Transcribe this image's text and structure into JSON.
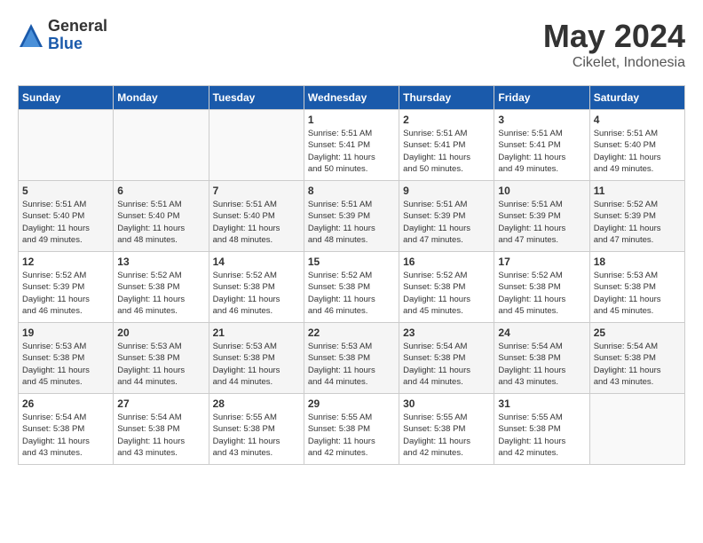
{
  "logo": {
    "general": "General",
    "blue": "Blue"
  },
  "title": {
    "month": "May 2024",
    "location": "Cikelet, Indonesia"
  },
  "headers": [
    "Sunday",
    "Monday",
    "Tuesday",
    "Wednesday",
    "Thursday",
    "Friday",
    "Saturday"
  ],
  "weeks": [
    [
      {
        "day": "",
        "info": ""
      },
      {
        "day": "",
        "info": ""
      },
      {
        "day": "",
        "info": ""
      },
      {
        "day": "1",
        "info": "Sunrise: 5:51 AM\nSunset: 5:41 PM\nDaylight: 11 hours\nand 50 minutes."
      },
      {
        "day": "2",
        "info": "Sunrise: 5:51 AM\nSunset: 5:41 PM\nDaylight: 11 hours\nand 50 minutes."
      },
      {
        "day": "3",
        "info": "Sunrise: 5:51 AM\nSunset: 5:41 PM\nDaylight: 11 hours\nand 49 minutes."
      },
      {
        "day": "4",
        "info": "Sunrise: 5:51 AM\nSunset: 5:40 PM\nDaylight: 11 hours\nand 49 minutes."
      }
    ],
    [
      {
        "day": "5",
        "info": "Sunrise: 5:51 AM\nSunset: 5:40 PM\nDaylight: 11 hours\nand 49 minutes."
      },
      {
        "day": "6",
        "info": "Sunrise: 5:51 AM\nSunset: 5:40 PM\nDaylight: 11 hours\nand 48 minutes."
      },
      {
        "day": "7",
        "info": "Sunrise: 5:51 AM\nSunset: 5:40 PM\nDaylight: 11 hours\nand 48 minutes."
      },
      {
        "day": "8",
        "info": "Sunrise: 5:51 AM\nSunset: 5:39 PM\nDaylight: 11 hours\nand 48 minutes."
      },
      {
        "day": "9",
        "info": "Sunrise: 5:51 AM\nSunset: 5:39 PM\nDaylight: 11 hours\nand 47 minutes."
      },
      {
        "day": "10",
        "info": "Sunrise: 5:51 AM\nSunset: 5:39 PM\nDaylight: 11 hours\nand 47 minutes."
      },
      {
        "day": "11",
        "info": "Sunrise: 5:52 AM\nSunset: 5:39 PM\nDaylight: 11 hours\nand 47 minutes."
      }
    ],
    [
      {
        "day": "12",
        "info": "Sunrise: 5:52 AM\nSunset: 5:39 PM\nDaylight: 11 hours\nand 46 minutes."
      },
      {
        "day": "13",
        "info": "Sunrise: 5:52 AM\nSunset: 5:38 PM\nDaylight: 11 hours\nand 46 minutes."
      },
      {
        "day": "14",
        "info": "Sunrise: 5:52 AM\nSunset: 5:38 PM\nDaylight: 11 hours\nand 46 minutes."
      },
      {
        "day": "15",
        "info": "Sunrise: 5:52 AM\nSunset: 5:38 PM\nDaylight: 11 hours\nand 46 minutes."
      },
      {
        "day": "16",
        "info": "Sunrise: 5:52 AM\nSunset: 5:38 PM\nDaylight: 11 hours\nand 45 minutes."
      },
      {
        "day": "17",
        "info": "Sunrise: 5:52 AM\nSunset: 5:38 PM\nDaylight: 11 hours\nand 45 minutes."
      },
      {
        "day": "18",
        "info": "Sunrise: 5:53 AM\nSunset: 5:38 PM\nDaylight: 11 hours\nand 45 minutes."
      }
    ],
    [
      {
        "day": "19",
        "info": "Sunrise: 5:53 AM\nSunset: 5:38 PM\nDaylight: 11 hours\nand 45 minutes."
      },
      {
        "day": "20",
        "info": "Sunrise: 5:53 AM\nSunset: 5:38 PM\nDaylight: 11 hours\nand 44 minutes."
      },
      {
        "day": "21",
        "info": "Sunrise: 5:53 AM\nSunset: 5:38 PM\nDaylight: 11 hours\nand 44 minutes."
      },
      {
        "day": "22",
        "info": "Sunrise: 5:53 AM\nSunset: 5:38 PM\nDaylight: 11 hours\nand 44 minutes."
      },
      {
        "day": "23",
        "info": "Sunrise: 5:54 AM\nSunset: 5:38 PM\nDaylight: 11 hours\nand 44 minutes."
      },
      {
        "day": "24",
        "info": "Sunrise: 5:54 AM\nSunset: 5:38 PM\nDaylight: 11 hours\nand 43 minutes."
      },
      {
        "day": "25",
        "info": "Sunrise: 5:54 AM\nSunset: 5:38 PM\nDaylight: 11 hours\nand 43 minutes."
      }
    ],
    [
      {
        "day": "26",
        "info": "Sunrise: 5:54 AM\nSunset: 5:38 PM\nDaylight: 11 hours\nand 43 minutes."
      },
      {
        "day": "27",
        "info": "Sunrise: 5:54 AM\nSunset: 5:38 PM\nDaylight: 11 hours\nand 43 minutes."
      },
      {
        "day": "28",
        "info": "Sunrise: 5:55 AM\nSunset: 5:38 PM\nDaylight: 11 hours\nand 43 minutes."
      },
      {
        "day": "29",
        "info": "Sunrise: 5:55 AM\nSunset: 5:38 PM\nDaylight: 11 hours\nand 42 minutes."
      },
      {
        "day": "30",
        "info": "Sunrise: 5:55 AM\nSunset: 5:38 PM\nDaylight: 11 hours\nand 42 minutes."
      },
      {
        "day": "31",
        "info": "Sunrise: 5:55 AM\nSunset: 5:38 PM\nDaylight: 11 hours\nand 42 minutes."
      },
      {
        "day": "",
        "info": ""
      }
    ]
  ]
}
